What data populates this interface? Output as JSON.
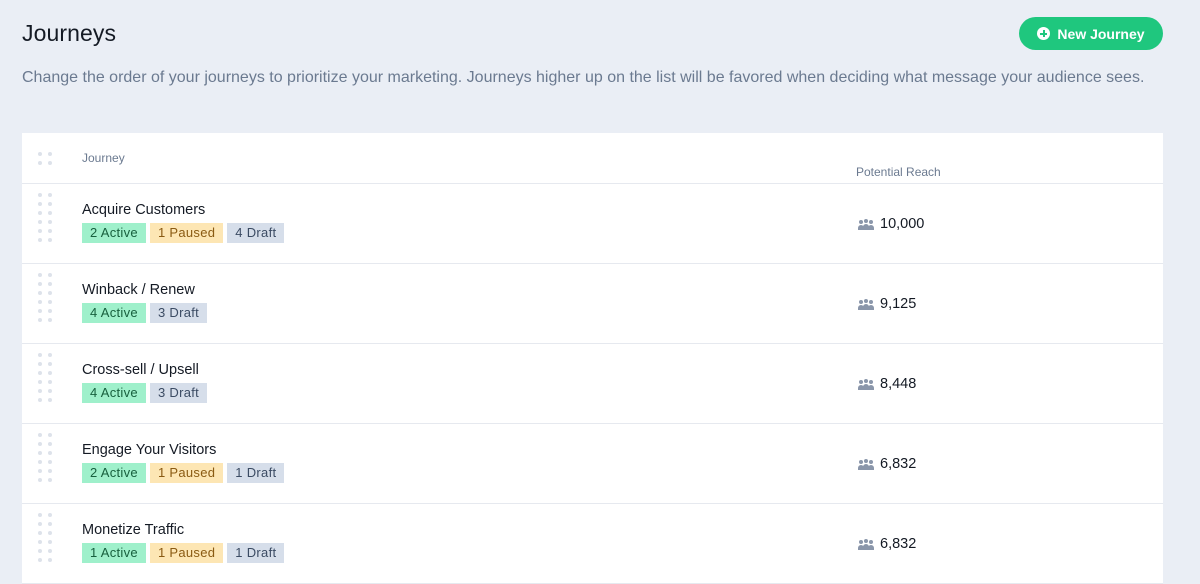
{
  "header": {
    "title": "Journeys",
    "new_button_label": "New Journey"
  },
  "description": "Change the order of your journeys to prioritize your marketing. Journeys higher up on the list will be favored when deciding what message your audience sees.",
  "table": {
    "columns": {
      "journey": "Journey",
      "reach": "Potential Reach"
    },
    "rows": [
      {
        "name": "Acquire Customers",
        "active": "2 Active",
        "paused": "1 Paused",
        "draft": "4 Draft",
        "reach": "10,000"
      },
      {
        "name": "Winback / Renew",
        "active": "4 Active",
        "paused": null,
        "draft": "3 Draft",
        "reach": "9,125"
      },
      {
        "name": "Cross-sell / Upsell",
        "active": "4 Active",
        "paused": null,
        "draft": "3 Draft",
        "reach": "8,448"
      },
      {
        "name": "Engage Your Visitors",
        "active": "2 Active",
        "paused": "1 Paused",
        "draft": "1 Draft",
        "reach": "6,832"
      },
      {
        "name": "Monetize Traffic",
        "active": "1 Active",
        "paused": "1 Paused",
        "draft": "1 Draft",
        "reach": "6,832"
      }
    ]
  },
  "colors": {
    "accent": "#1fc77e",
    "background": "#eaeef5",
    "active_badge": "#9ff0cb",
    "paused_badge": "#fde6b4",
    "draft_badge": "#d6deea"
  },
  "icons": {
    "new_button": "plus-circle-icon",
    "reach": "people-icon",
    "drag": "drag-handle-icon"
  }
}
